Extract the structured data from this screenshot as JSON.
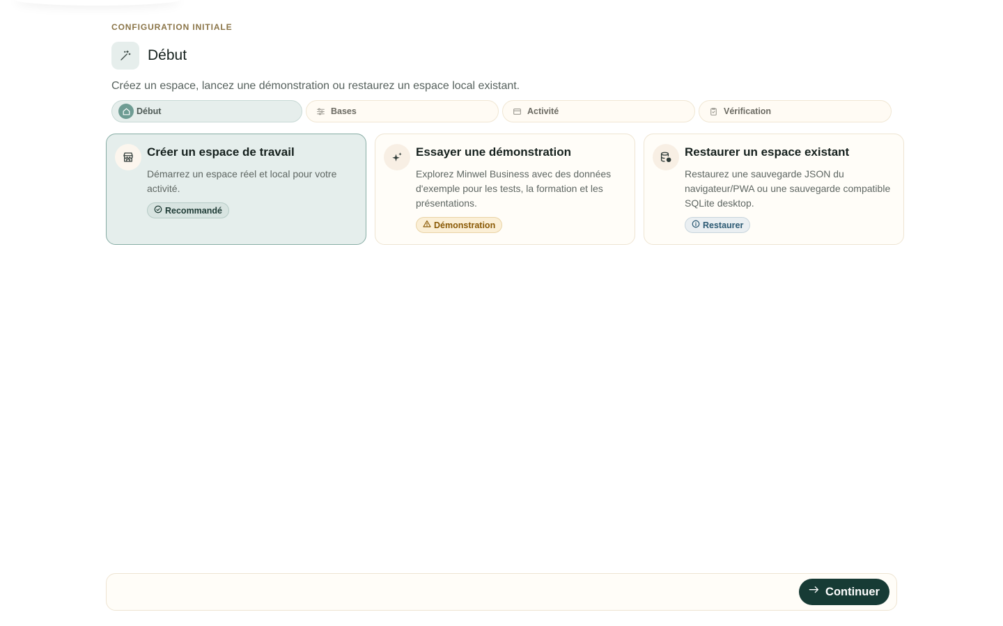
{
  "header": {
    "eyebrow": "CONFIGURATION INITIALE",
    "title": "Début",
    "title_icon": "magic-wand-icon",
    "subtitle": "Créez un espace, lancez une démonstration ou restaurez un espace local existant."
  },
  "steps": [
    {
      "label": "Début",
      "icon": "home-icon",
      "active": true
    },
    {
      "label": "Bases",
      "icon": "sliders-icon",
      "active": false
    },
    {
      "label": "Activité",
      "icon": "card-icon",
      "active": false
    },
    {
      "label": "Vérification",
      "icon": "clipboard-check-icon",
      "active": false
    }
  ],
  "options": [
    {
      "title": "Créer un espace de travail",
      "description": "Démarrez un espace réel et local pour votre activité.",
      "badge": "Recommandé",
      "icon": "store-icon",
      "badge_icon": "check-circle-icon",
      "selected": true
    },
    {
      "title": "Essayer une démonstration",
      "description": "Explorez Minwel Business avec des données d'exemple pour les tests, la formation et les présentations.",
      "badge": "Démonstration",
      "icon": "sparkles-icon",
      "badge_icon": "warning-icon",
      "selected": false
    },
    {
      "title": "Restaurer un espace existant",
      "description": "Restaurez une sauvegarde JSON du navigateur/PWA ou une sauvegarde compatible SQLite desktop.",
      "badge": "Restaurer",
      "icon": "database-restore-icon",
      "badge_icon": "info-icon",
      "selected": false
    }
  ],
  "footer": {
    "continue_label": "Continuer",
    "continue_icon": "arrow-right-icon"
  },
  "colors": {
    "accent": "#173b35",
    "eyebrow": "#8a7447",
    "selected_bg": "#e5eeec",
    "card_bg": "#fffdf8"
  }
}
